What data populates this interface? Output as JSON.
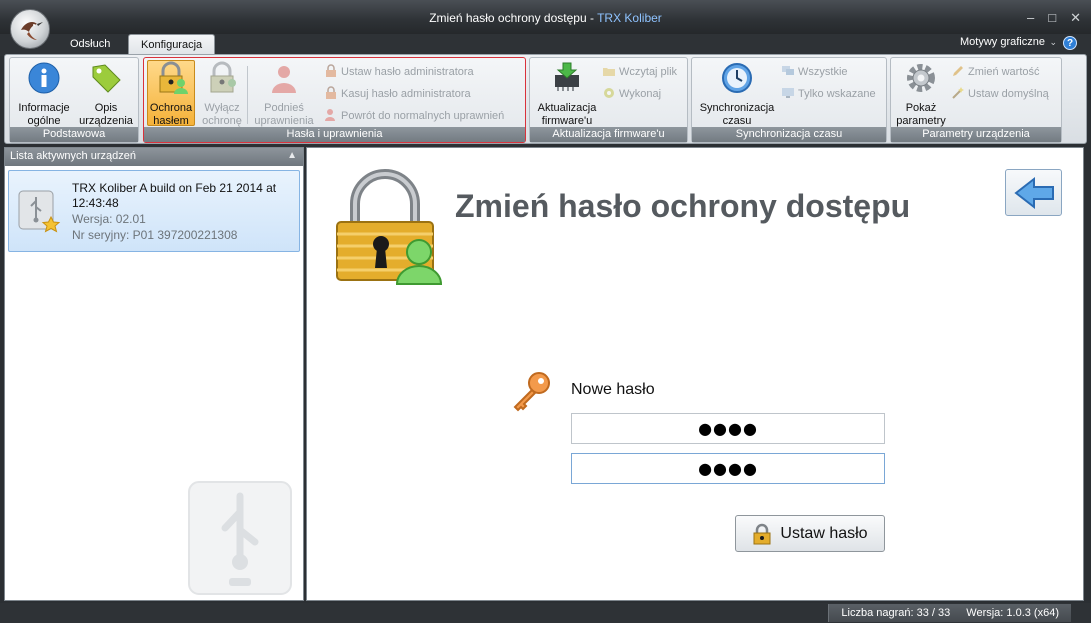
{
  "window": {
    "title": "Zmień hasło ochrony dostępu",
    "title_sep": " - ",
    "app_name": "TRX Koliber"
  },
  "tabs": [
    {
      "label": "Odsłuch"
    },
    {
      "label": "Konfiguracja"
    }
  ],
  "ribbon_right": {
    "themes_label": "Motywy graficzne",
    "help": "?"
  },
  "groups": {
    "basic": {
      "label": "Podstawowa",
      "info": "Informacje\nogólne",
      "desc": "Opis\nurządzenia"
    },
    "password": {
      "label": "Hasła i uprawnienia",
      "protect": "Ochrona\nhasłem",
      "disable": "Wyłącz\nochronę",
      "elevate": "Podnieś\nuprawnienia",
      "set_admin": "Ustaw hasło administratora",
      "clear_admin": "Kasuj hasło administratora",
      "revert": "Powrót do normalnych uprawnień"
    },
    "firmware": {
      "label": "Aktualizacja firmware'u",
      "update": "Aktualizacja\nfirmware'u",
      "load": "Wczytaj plik",
      "run": "Wykonaj"
    },
    "sync": {
      "label": "Synchronizacja czasu",
      "sync": "Synchronizacja\nczasu",
      "all": "Wszystkie",
      "only": "Tylko wskazane"
    },
    "params": {
      "label": "Parametry urządzenia",
      "show": "Pokaż\nparametry",
      "change": "Zmień wartość",
      "defaults": "Ustaw domyślną"
    }
  },
  "devices_pane": {
    "header": "Lista aktywnych urządzeń",
    "device": {
      "name": "TRX Koliber A build on Feb 21 2014 at 12:43:48",
      "version": "Wersja: 02.01",
      "serial": "Nr seryjny: P01 397200221308"
    }
  },
  "main": {
    "title": "Zmień hasło ochrony dostępu",
    "field_label": "Nowe hasło",
    "password1": "●●●●",
    "password2": "●●●●",
    "set_button": "Ustaw hasło"
  },
  "status": {
    "recordings": "Liczba nagrań: 33 / 33",
    "version": "Wersja: 1.0.3 (x64)"
  },
  "colors": {
    "accent": "#2f7fd6",
    "highlight_border": "#d9323b",
    "active_button": "#f5b23a"
  }
}
